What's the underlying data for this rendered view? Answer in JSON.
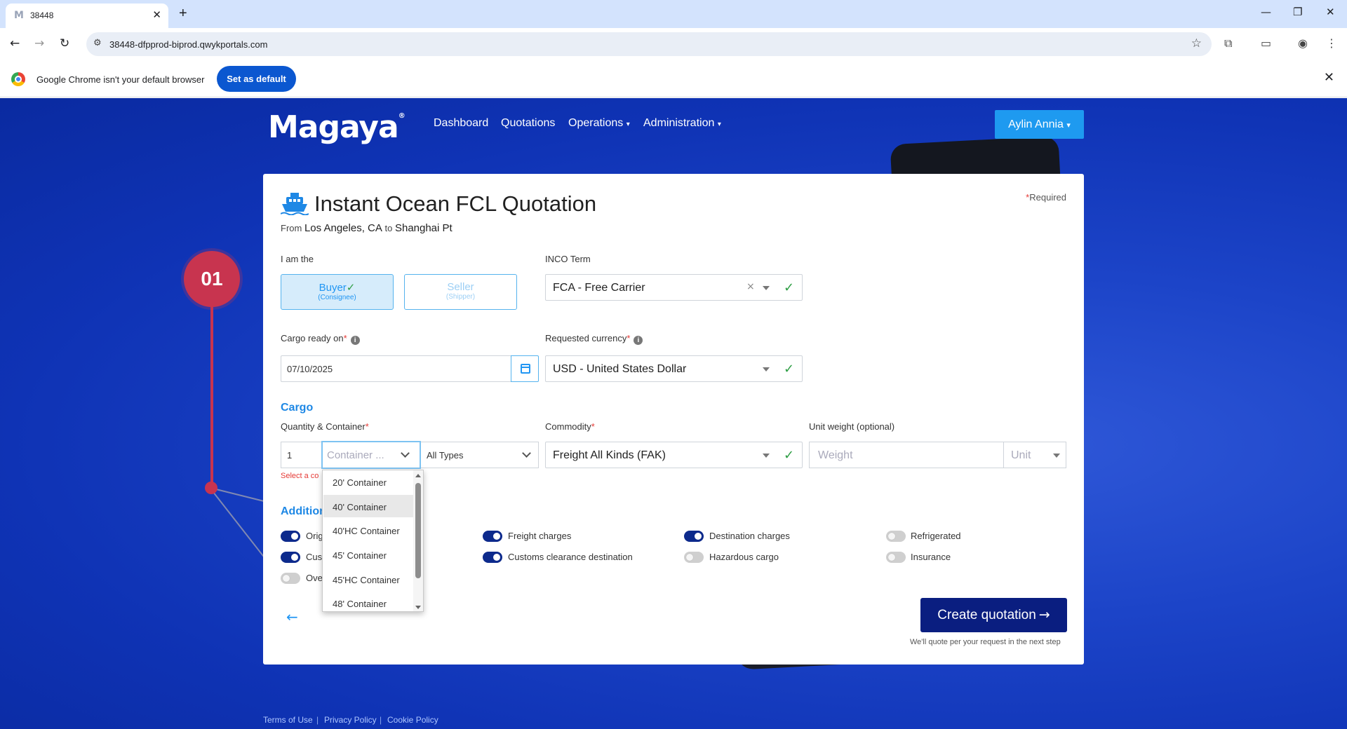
{
  "browser": {
    "tab_title": "38448",
    "tab_favicon": "M",
    "url": "38448-dfpprod-biprod.qwykportals.com",
    "infobar_text": "Google Chrome isn't your default browser",
    "infobar_button": "Set as default"
  },
  "topnav": {
    "logo": "Magaya",
    "logo_mark": "®",
    "items": [
      "Dashboard",
      "Quotations",
      "Operations",
      "Administration"
    ],
    "user": "Aylin Annia"
  },
  "step_badge": "01",
  "form": {
    "title": "Instant Ocean FCL Quotation",
    "required_note": "Required",
    "required_star": "*",
    "route_from_label": "From",
    "route_from": "Los Angeles, CA",
    "route_to_label": "to",
    "route_to": "Shanghai Pt",
    "iam_label": "I am the",
    "buyer_label": "Buyer",
    "buyer_sub": "(Consignee)",
    "seller_label": "Seller",
    "seller_sub": "(Shipper)",
    "inco_label": "INCO Term",
    "inco_value": "FCA - Free Carrier",
    "cargo_ready_label": "Cargo ready on",
    "cargo_ready_value": "07/10/2025",
    "currency_label": "Requested currency",
    "currency_value": "USD - United States Dollar",
    "cargo_section": "Cargo",
    "qty_label": "Quantity & Container",
    "qty_value": "1",
    "container_placeholder": "Container ...",
    "types_value": "All Types",
    "error_text": "Select a co",
    "commodity_label": "Commodity",
    "commodity_value": "Freight All Kinds (FAK)",
    "unit_weight_label": "Unit weight (optional)",
    "weight_placeholder": "Weight",
    "unit_placeholder": "Unit",
    "additional_section": "Addition",
    "create_button": "Create quotation",
    "create_note": "We'll quote per your request in the next step"
  },
  "toggles": [
    {
      "label": "Orig",
      "state": "on"
    },
    {
      "label": "Cus",
      "state": "on"
    },
    {
      "label": "Ove",
      "state": "off"
    },
    {
      "label": "Freight charges",
      "state": "on"
    },
    {
      "label": "Customs clearance destination",
      "state": "on"
    },
    {
      "label": "Destination charges",
      "state": "on"
    },
    {
      "label": "Hazardous cargo",
      "state": "off"
    },
    {
      "label": "Refrigerated",
      "state": "off"
    },
    {
      "label": "Insurance",
      "state": "off"
    }
  ],
  "container_options": [
    "20' Container",
    "40' Container",
    "40'HC Container",
    "45' Container",
    "45'HC Container",
    "48' Container"
  ],
  "hovered_option": "40' Container",
  "footer": [
    "Terms of Use",
    "Privacy Policy",
    "Cookie Policy"
  ],
  "colors": {
    "brand_blue": "#1c44c8",
    "accent": "#1e88e5",
    "primary_button": "#0a1e80",
    "step_badge": "#c8344f",
    "valid_check": "#2e9e44",
    "required_star": "#e53935"
  }
}
